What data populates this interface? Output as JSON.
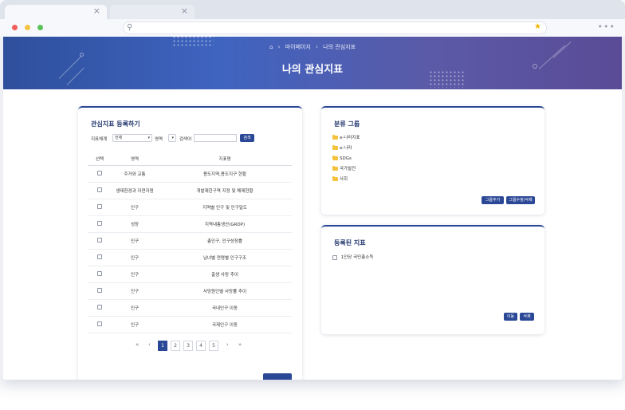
{
  "browser": {
    "close_glyph": "×",
    "search_glyph": "⚲",
    "bookmark_glyph": "★",
    "menu_glyph": "•••"
  },
  "breadcrumb": {
    "home_icon": "⌂",
    "separator": "›",
    "items": [
      "마이페이지",
      "나의 관심지표"
    ]
  },
  "banner": {
    "title": "나의 관심지표"
  },
  "register_panel": {
    "title": "관심지표 등록하기",
    "filters": {
      "system_label": "지표체계",
      "system_value": "전체",
      "area_label": "영역",
      "area_value": "",
      "keyword_label": "검색어",
      "keyword_value": "",
      "search_button": "검색"
    },
    "columns": [
      "선택",
      "영역",
      "지표명"
    ],
    "rows": [
      {
        "area": "주거와 교통",
        "name": "용도지역,용도지구 현황"
      },
      {
        "area": "생태환경과 자연자원",
        "name": "개발제한구역 지정 및 해제현황"
      },
      {
        "area": "인구",
        "name": "지역별 인구 및 인구밀도"
      },
      {
        "area": "성장",
        "name": "지역내총생산(GRDP)"
      },
      {
        "area": "인구",
        "name": "총인구, 인구성장률"
      },
      {
        "area": "인구",
        "name": "남녀별 연령별 인구구조"
      },
      {
        "area": "인구",
        "name": "출생 사망 추이"
      },
      {
        "area": "인구",
        "name": "사망원인별 사망률 추이"
      },
      {
        "area": "인구",
        "name": "국내인구 이동"
      },
      {
        "area": "인구",
        "name": "국제인구 이동"
      }
    ],
    "pagination": {
      "first": "«",
      "prev": "‹",
      "pages": [
        "1",
        "2",
        "3",
        "4",
        "5"
      ],
      "next": "›",
      "last": "»",
      "active_page": "1"
    }
  },
  "group_panel": {
    "title": "분류 그룹",
    "items": [
      "e-나라지표",
      "e-나라",
      "SDGs",
      "국가발전",
      "사회"
    ],
    "add_button": "그룹추가",
    "edit_button": "그룹수정/삭제"
  },
  "registered_panel": {
    "title": "등록된 지표",
    "items": [
      "1인당 국민총소득"
    ],
    "move_button": "이동",
    "delete_button": "삭제"
  },
  "colors": {
    "primary": "#2b4896",
    "banner_start": "#2f4f9c",
    "banner_end": "#5a4b96",
    "folder": "#f4c23c"
  }
}
